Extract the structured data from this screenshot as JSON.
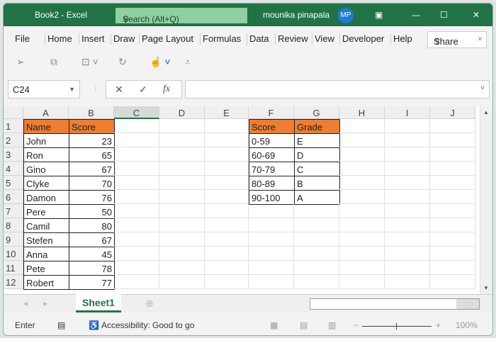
{
  "title": {
    "app": "Book2  -  Excel",
    "search": "Search (Alt+Q)",
    "user": "mounika pinapala",
    "initials": "MP"
  },
  "menu": [
    "File",
    "Home",
    "Insert",
    "Draw",
    "Page Layout",
    "Formulas",
    "Data",
    "Review",
    "View",
    "Developer",
    "Help"
  ],
  "share": "Share",
  "namebox": "C24",
  "columns": [
    "A",
    "B",
    "C",
    "D",
    "E",
    "F",
    "G",
    "H",
    "I",
    "J"
  ],
  "rows": [
    "1",
    "2",
    "3",
    "4",
    "5",
    "6",
    "7",
    "8",
    "9",
    "10",
    "11",
    "12"
  ],
  "students": {
    "headers": [
      "Name",
      "Score"
    ],
    "data": [
      [
        "John",
        "23"
      ],
      [
        "Ron",
        "65"
      ],
      [
        "Gino",
        "67"
      ],
      [
        "Clyke",
        "70"
      ],
      [
        "Damon",
        "76"
      ],
      [
        "Pere",
        "50"
      ],
      [
        "Camil",
        "80"
      ],
      [
        "Stefen",
        "67"
      ],
      [
        "Anna",
        "45"
      ],
      [
        "Pete",
        "78"
      ],
      [
        "Robert",
        "77"
      ]
    ]
  },
  "grades": {
    "headers": [
      "Score",
      "Grade"
    ],
    "data": [
      [
        "0-59",
        "E"
      ],
      [
        "60-69",
        "D"
      ],
      [
        "70-79",
        "C"
      ],
      [
        "80-89",
        "B"
      ],
      [
        "90-100",
        "A"
      ]
    ]
  },
  "sheet_tab": "Sheet1",
  "status": {
    "mode": "Enter",
    "accessibility": "Accessibility: Good to go",
    "zoom": "100%"
  },
  "colors": {
    "accent": "#217346",
    "header_fill": "#ed7d31"
  }
}
